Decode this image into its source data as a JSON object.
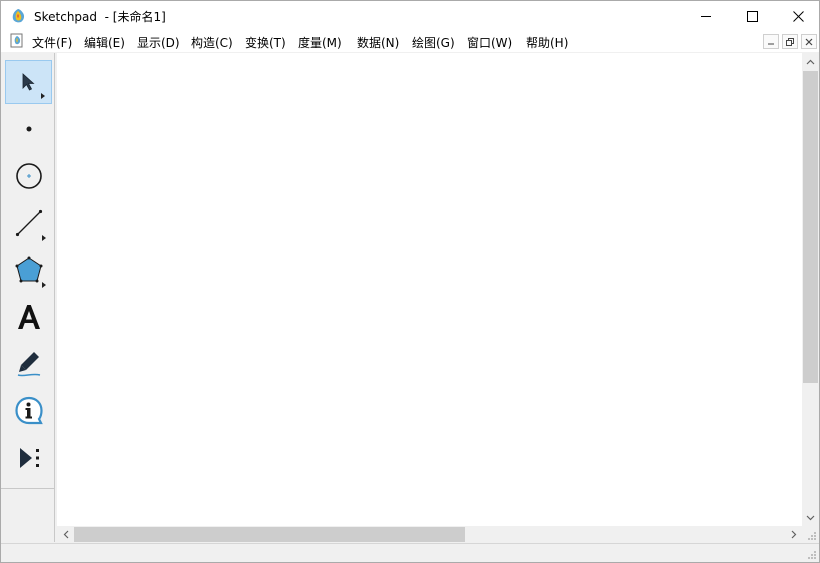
{
  "window": {
    "title": "Sketchpad  - [未命名1]"
  },
  "menubar": {
    "items": [
      {
        "label": "文件(F)"
      },
      {
        "label": "编辑(E)"
      },
      {
        "label": "显示(D)"
      },
      {
        "label": "构造(C)"
      },
      {
        "label": "变换(T)"
      },
      {
        "label": "度量(M)"
      },
      {
        "label": "数据(N)"
      },
      {
        "label": "绘图(G)"
      },
      {
        "label": "窗口(W)"
      },
      {
        "label": "帮助(H)"
      }
    ]
  },
  "toolbox": {
    "selected_tool": "arrow",
    "tools": [
      {
        "icon": "arrow-select-icon"
      },
      {
        "icon": "point-icon"
      },
      {
        "icon": "compass-icon"
      },
      {
        "icon": "straightedge-icon"
      },
      {
        "icon": "polygon-icon"
      },
      {
        "icon": "text-icon"
      },
      {
        "icon": "marker-icon"
      },
      {
        "icon": "information-icon"
      },
      {
        "icon": "custom-tool-icon"
      }
    ]
  },
  "colors": {
    "selected_tool_bg": "#cce4f7",
    "polygon_fill": "#4a9fd5",
    "info_blue": "#3a8fc8"
  }
}
